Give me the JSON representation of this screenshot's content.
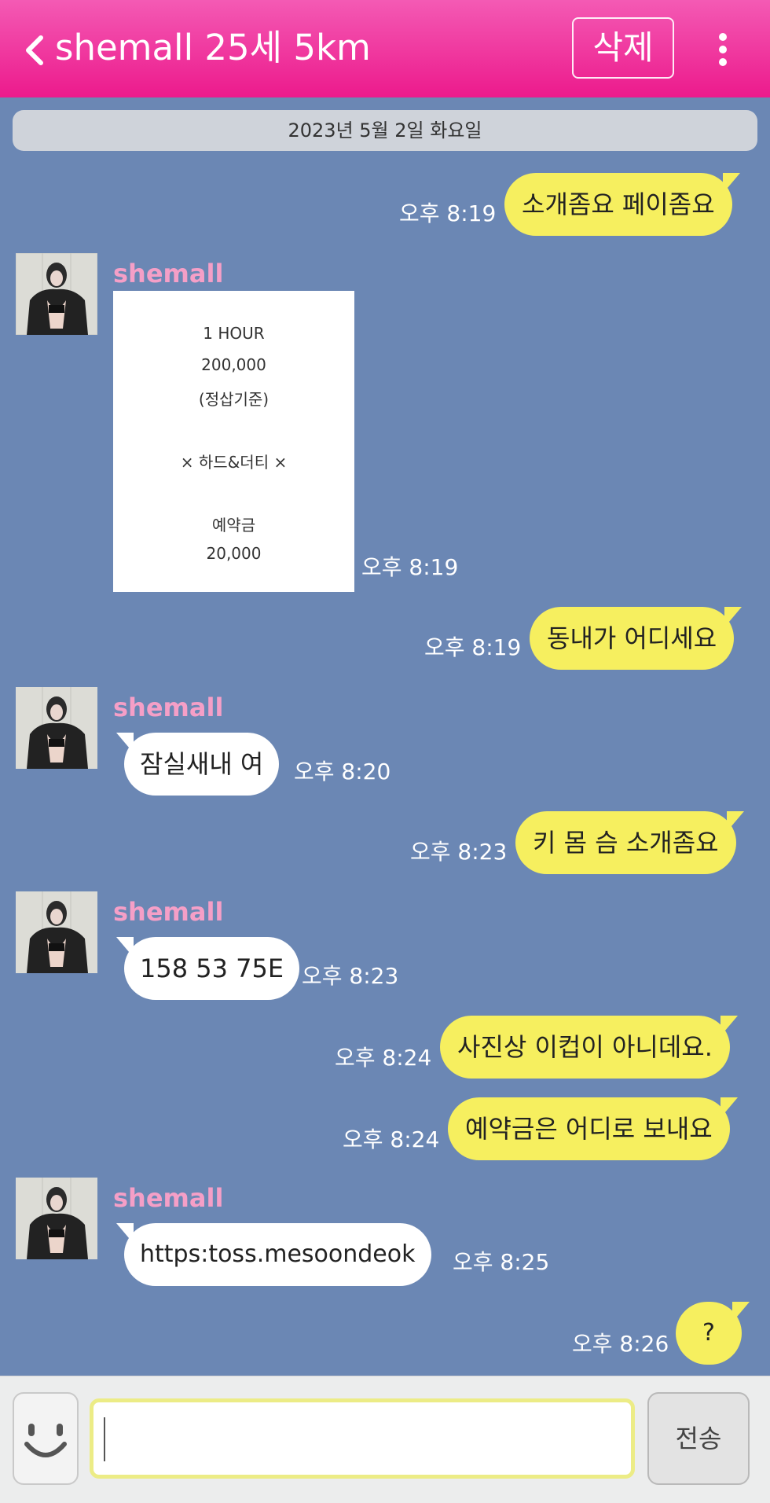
{
  "header": {
    "title": "shemall 25세 5km",
    "delete_label": "삭제",
    "back_icon": "chevron-left-icon",
    "more_icon": "more-vertical-icon",
    "color": "#ec1a8c"
  },
  "date_divider": "2023년 5월 2일 화요일",
  "chat": {
    "sender_name": "shemall",
    "messages": [
      {
        "from": "me",
        "text": "소개좀요 페이좀요",
        "time": "오후 8:19"
      },
      {
        "from": "them",
        "type": "image",
        "time": "오후 8:19",
        "image_lines": [
          "1 HOUR",
          "200,000",
          "(정삽기준)",
          "× 하드&더티 ×",
          "예약금",
          "20,000"
        ]
      },
      {
        "from": "me",
        "text": "동내가 어디세요",
        "time": "오후 8:19"
      },
      {
        "from": "them",
        "text": "잠실새내 여",
        "time": "오후 8:20"
      },
      {
        "from": "me",
        "text": "키 몸 슴 소개좀요",
        "time": "오후 8:23"
      },
      {
        "from": "them",
        "text": "158 53 75E",
        "time": "오후 8:23"
      },
      {
        "from": "me",
        "text": "사진상 이컵이 아니데요.",
        "time": "오후 8:24"
      },
      {
        "from": "me",
        "text": "예약금은 어디로 보내요",
        "time": "오후 8:24"
      },
      {
        "from": "them",
        "text": "https:toss.mesoondeok",
        "time": "오후 8:25"
      },
      {
        "from": "me",
        "text": "?",
        "time": "오후 8:26"
      }
    ]
  },
  "input": {
    "value": "",
    "send_label": "전송",
    "emoji_icon": "smiley-icon"
  }
}
